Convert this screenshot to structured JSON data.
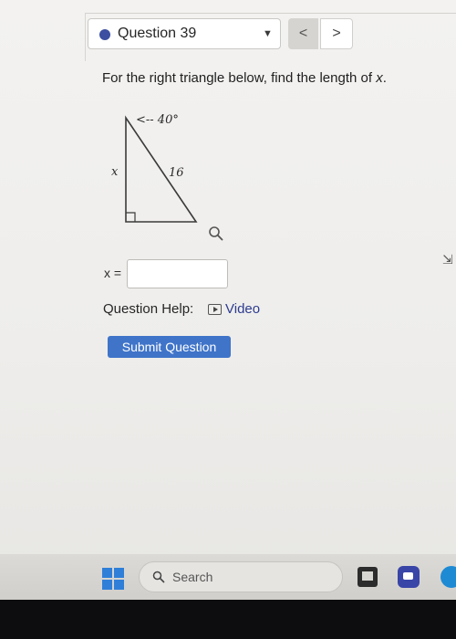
{
  "header": {
    "question_label": "Question 39",
    "prev_label": "<",
    "next_label": ">"
  },
  "problem": {
    "prompt_text": "For the right triangle below, find the length of ",
    "prompt_var": "x",
    "prompt_end": ".",
    "figure": {
      "angle_label": "<-- 40°",
      "side_label_x": "x",
      "side_label_hyp": "16"
    }
  },
  "answer": {
    "label": "x =",
    "value": "",
    "placeholder": ""
  },
  "help": {
    "label": "Question Help:",
    "video_label": "Video"
  },
  "actions": {
    "submit_label": "Submit Question"
  },
  "taskbar": {
    "search_placeholder": "Search"
  },
  "colors": {
    "accent": "#3f74c9",
    "question_dot": "#3c4fa0",
    "link": "#2d3c8f"
  }
}
